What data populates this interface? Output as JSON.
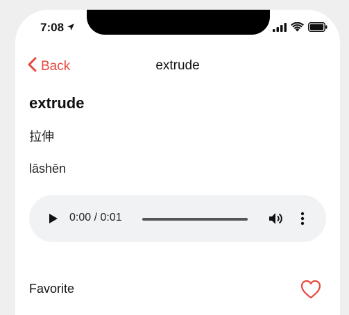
{
  "status_bar": {
    "time": "7:08"
  },
  "navbar": {
    "back_label": "Back",
    "title": "extrude"
  },
  "entry": {
    "word": "extrude",
    "translation": "拉伸",
    "pinyin": "lāshēn"
  },
  "audio_player": {
    "time_display": "0:00 / 0:01"
  },
  "favorite": {
    "label": "Favorite",
    "accent_color": "#e5483e"
  }
}
